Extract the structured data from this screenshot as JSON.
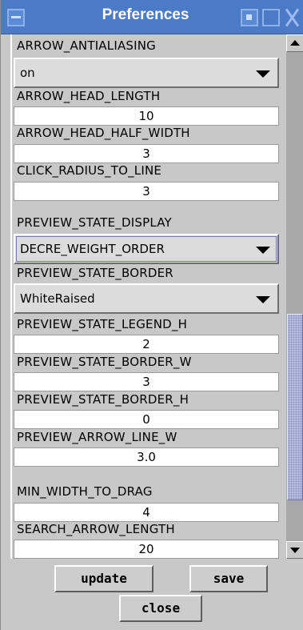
{
  "window": {
    "title": "Preferences"
  },
  "rows": [
    {
      "label": "ARROW_ANTIALIASING",
      "value": "on"
    },
    {
      "label": "ARROW_HEAD_LENGTH",
      "value": "10"
    },
    {
      "label": "ARROW_HEAD_HALF_WIDTH",
      "value": "3"
    },
    {
      "label": "CLICK_RADIUS_TO_LINE",
      "value": "3"
    },
    {
      "label": "PREVIEW_STATE_DISPLAY",
      "value": "DECRE_WEIGHT_ORDER"
    },
    {
      "label": "PREVIEW_STATE_BORDER",
      "value": "WhiteRaised"
    },
    {
      "label": "PREVIEW_STATE_LEGEND_H",
      "value": "2"
    },
    {
      "label": "PREVIEW_STATE_BORDER_W",
      "value": "3"
    },
    {
      "label": "PREVIEW_STATE_BORDER_H",
      "value": "0"
    },
    {
      "label": "PREVIEW_ARROW_LINE_W",
      "value": "3.0"
    },
    {
      "label": "MIN_WIDTH_TO_DRAG",
      "value": "4"
    },
    {
      "label": "SEARCH_ARROW_LENGTH",
      "value": "20"
    }
  ],
  "buttons": {
    "update": "update",
    "save": "save",
    "close": "close"
  },
  "colors": {
    "titlebar": "#4b7ac6",
    "background": "#c8c8c8",
    "field": "#ffffff",
    "scroll_thumb": "#b8bfe0"
  },
  "icons": [
    "window-menu-icon",
    "minimize-icon",
    "maximize-icon",
    "close-icon",
    "scroll-up-arrow-icon",
    "scroll-down-arrow-icon",
    "dropdown-arrow-icon"
  ]
}
